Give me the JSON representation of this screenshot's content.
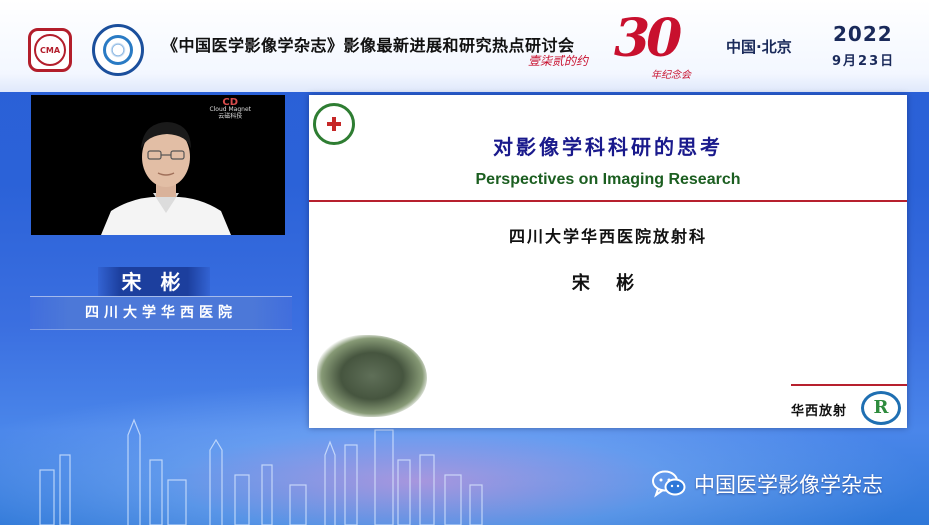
{
  "header": {
    "conference_title": "《中国医学影像学杂志》影像最新进展和研究热点研讨会",
    "anniversary_number": "30",
    "anniversary_slogan": "壹柒贰的约",
    "anniversary_subtitle": "年纪念会",
    "location": "中国·北京",
    "year": "2022",
    "date": "9月23日",
    "logo_left_text": "CMA"
  },
  "video": {
    "watermark_brand": "Cloud Magnet",
    "watermark_sub": "云磁科技",
    "watermark_mark": "CD"
  },
  "speaker": {
    "name": "宋 彬",
    "affiliation": "四川大学华西医院"
  },
  "slide": {
    "title_cn": "对影像学科科研的思考",
    "title_en": "Perspectives on Imaging Research",
    "department": "四川大学华西医院放射科",
    "author": "宋 彬",
    "footer_label": "华西放射",
    "footer_logo_letter": "R"
  },
  "watermark": {
    "label": "中国医学影像学杂志"
  },
  "colors": {
    "brand_red": "#b7202e",
    "title_blue": "#1a1a8c",
    "subtitle_green": "#1b5e20",
    "background_blue": "#2b62d8"
  }
}
